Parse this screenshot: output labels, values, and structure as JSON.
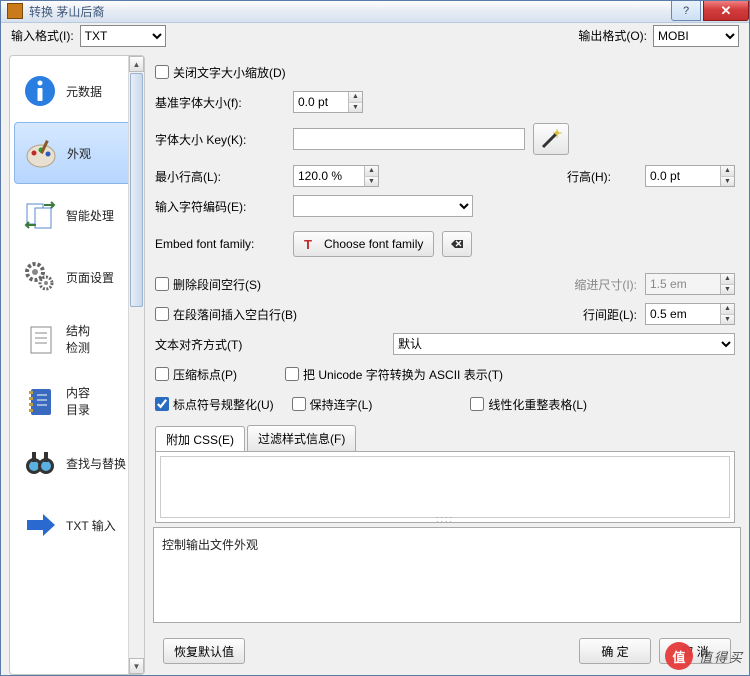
{
  "window": {
    "title": "转换 茅山后裔"
  },
  "formatbar": {
    "input_label": "输入格式(I):",
    "input_value": "TXT",
    "output_label": "输出格式(O):",
    "output_value": "MOBI"
  },
  "sidebar": {
    "items": [
      {
        "label": "元数据"
      },
      {
        "label": "外观"
      },
      {
        "label": "智能处理"
      },
      {
        "label": "页面设置"
      },
      {
        "label": "结构\n检测"
      },
      {
        "label": "内容\n目录"
      },
      {
        "label": "查找与替换"
      },
      {
        "label": "TXT 输入"
      }
    ]
  },
  "settings": {
    "disable_font_rescaling": "关闭文字大小缩放(D)",
    "base_font_size_label": "基准字体大小(f):",
    "base_font_size_value": "0.0 pt",
    "font_size_key_label": "字体大小 Key(K):",
    "font_size_key_value": "",
    "min_line_height_label": "最小行高(L):",
    "min_line_height_value": "120.0 %",
    "line_height_label": "行高(H):",
    "line_height_value": "0.0 pt",
    "input_encoding_label": "输入字符编码(E):",
    "input_encoding_value": "",
    "embed_font_label": "Embed font family:",
    "choose_font_btn": "Choose font family",
    "remove_blank_lines": "删除段间空行(S)",
    "indent_size_label": "缩进尺寸(I):",
    "indent_size_value": "1.5 em",
    "insert_blank_line": "在段落间插入空白行(B)",
    "line_spacing_label": "行间距(L):",
    "line_spacing_value": "0.5 em",
    "text_align_label": "文本对齐方式(T)",
    "text_align_value": "默认",
    "compress_punct": "压缩标点(P)",
    "unicode_to_ascii": "把 Unicode 字符转换为 ASCII 表示(T)",
    "normalize_punct": "标点符号规整化(U)",
    "keep_ligatures": "保持连字(L)",
    "linearize_tables": "线性化重整表格(L)",
    "tabs": {
      "extra_css": "附加 CSS(E)",
      "filter_style": "过滤样式信息(F)"
    }
  },
  "description": "控制输出文件外观",
  "footer": {
    "restore_defaults": "恢复默认值",
    "ok": "确 定",
    "cancel": "取 消"
  },
  "watermark": {
    "circle": "值",
    "text": "值得买"
  }
}
